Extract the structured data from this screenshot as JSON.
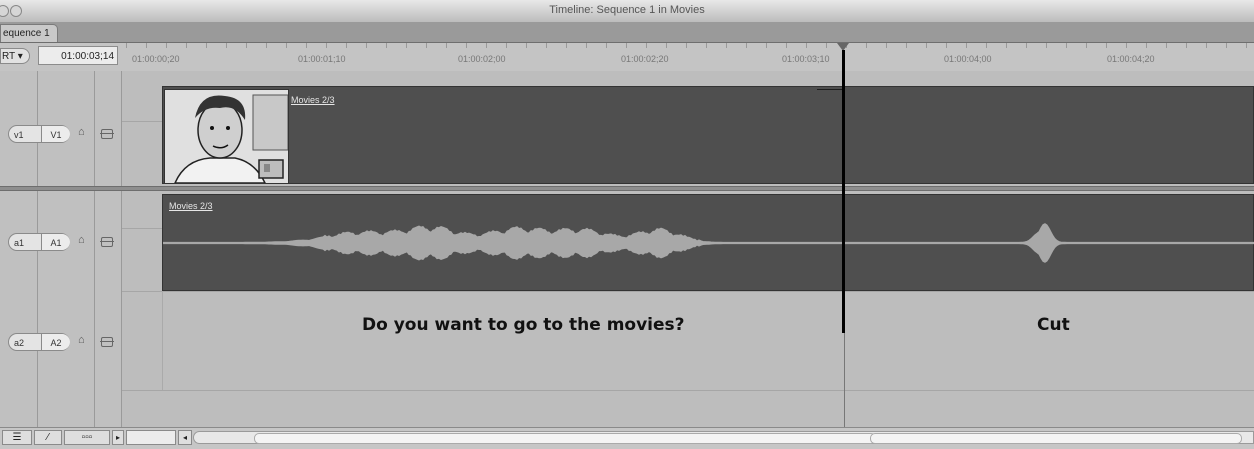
{
  "window": {
    "title": "Timeline: Sequence 1 in Movies"
  },
  "tabs": [
    {
      "label": "equence 1"
    }
  ],
  "toolbar": {
    "rt_label": "RT ▾",
    "current_timecode": "01:00:03;14"
  },
  "ruler": {
    "labels": [
      "01:00:00;20",
      "01:00:01;10",
      "01:00:02;00",
      "01:00:02;20",
      "01:00:03;10",
      "01:00:04;00",
      "01:00:04;20"
    ]
  },
  "tracks": [
    {
      "source": "v1",
      "dest": "V1",
      "clip_name": "Movies 2/3"
    },
    {
      "source": "a1",
      "dest": "A1",
      "clip_name": "Movies 2/3"
    },
    {
      "source": "a2",
      "dest": "A2"
    }
  ],
  "captions": {
    "left": "Do you want to go to the movies?",
    "right": "Cut"
  },
  "icons": {
    "lock": "lock-icon",
    "sync": "sync-icon",
    "playhead": "playhead-icon"
  }
}
